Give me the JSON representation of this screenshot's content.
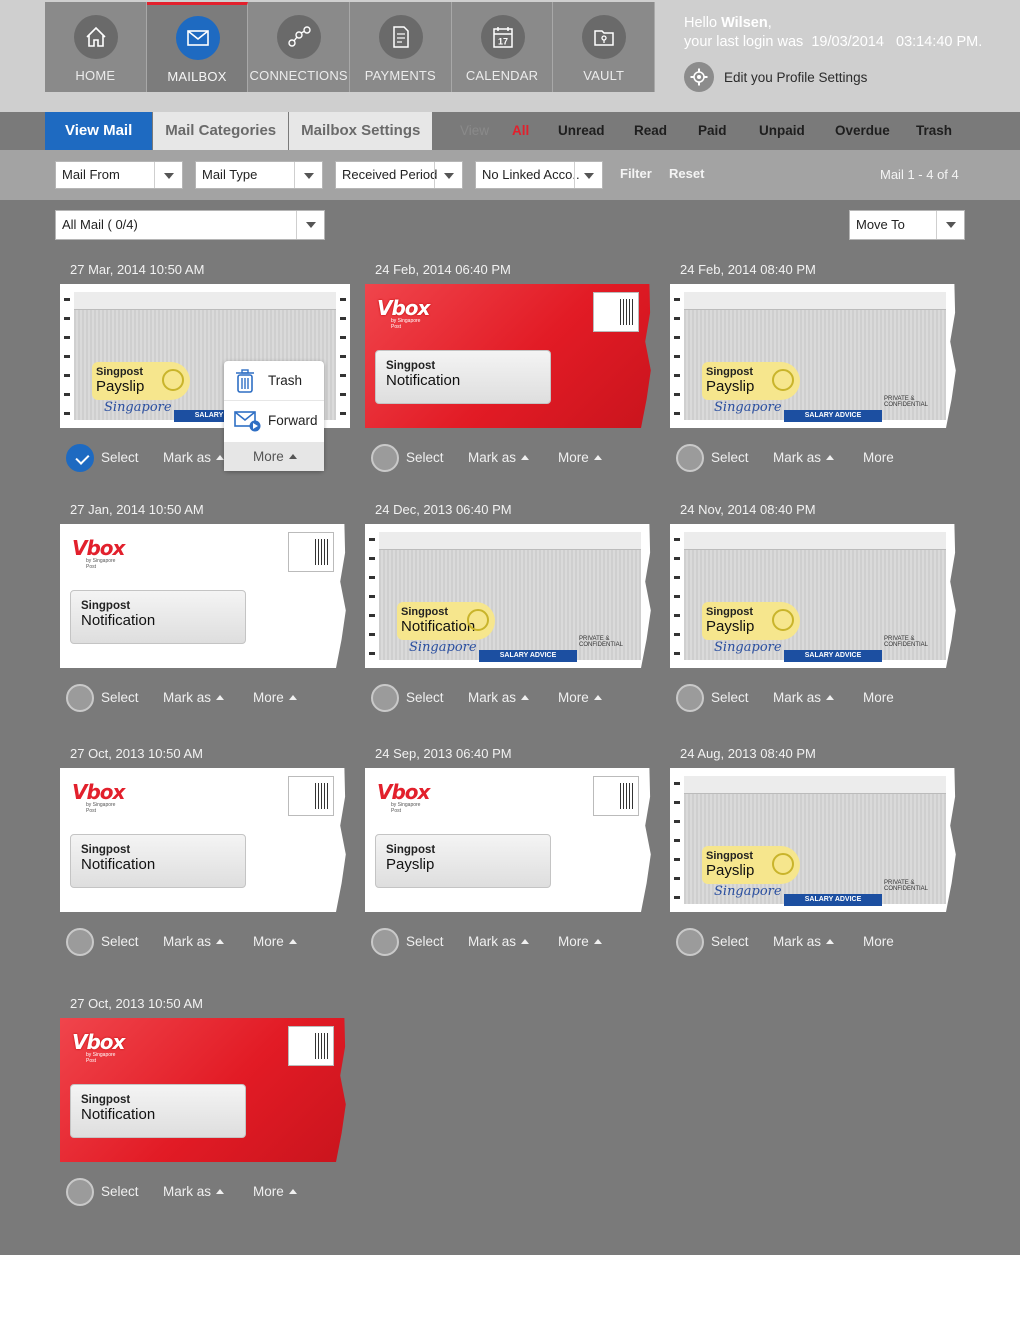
{
  "nav": [
    {
      "label": "HOME",
      "icon": "home-icon"
    },
    {
      "label": "MAILBOX",
      "icon": "mailbox-icon",
      "active": true
    },
    {
      "label": "CONNECTIONS",
      "icon": "connections-icon"
    },
    {
      "label": "PAYMENTS",
      "icon": "payments-icon"
    },
    {
      "label": "CALENDAR",
      "icon": "calendar-icon"
    },
    {
      "label": "VAULT",
      "icon": "vault-icon"
    }
  ],
  "calendar_day": "17",
  "user": {
    "hello": "Hello",
    "name": "Wilsen",
    "comma": ",",
    "last_login_prefix": "your last login was",
    "last_login_date": "19/03/2014",
    "last_login_time": "03:14:40 PM.",
    "profile_link": "Edit you Profile Settings"
  },
  "tabs": [
    "View Mail",
    "Mail Categories",
    "Mailbox Settings"
  ],
  "view": {
    "label": "View",
    "options": [
      "All",
      "Unread",
      "Read",
      "Paid",
      "Unpaid",
      "Overdue",
      "Trash"
    ],
    "active": "All"
  },
  "filters": {
    "mail_from": "Mail From",
    "mail_type": "Mail Type",
    "received_period": "Received Period",
    "linked_account": "No Linked Acco..",
    "filter": "Filter",
    "reset": "Reset",
    "count": "Mail 1 - 4 of 4"
  },
  "all_mail_select": "All Mail ( 0/4)",
  "move_to": "Move To",
  "actions": {
    "select": "Select",
    "mark_as": "Mark as",
    "more": "More"
  },
  "popup": {
    "trash": "Trash",
    "forward": "Forward",
    "more": "More"
  },
  "brand": {
    "vbox": "Vbox",
    "vbox_sub": "by Singapore Post",
    "sg_logo": "Singapore",
    "salary_advice": "SALARY ADVICE",
    "private": "PRIVATE & CONFIDENTIAL"
  },
  "colors": {
    "accent_blue": "#1e6ac1",
    "accent_red": "#e2202c",
    "background": "#7a7a7a"
  },
  "mails": [
    {
      "date": "27 Mar, 2014 10:50 AM",
      "style": "payslip",
      "line1": "Singpost",
      "line2": "Payslip",
      "selected": true,
      "more_arrow": true
    },
    {
      "date": "24 Feb, 2014 06:40 PM",
      "style": "red",
      "line1": "Singpost",
      "line2": "Notification",
      "selected": false,
      "more_arrow": true
    },
    {
      "date": "24 Feb, 2014 08:40 PM",
      "style": "payslip",
      "line1": "Singpost",
      "line2": "Payslip",
      "selected": false,
      "more_arrow": false
    },
    {
      "date": "27 Jan, 2014 10:50 AM",
      "style": "white",
      "line1": "Singpost",
      "line2": "Notification",
      "selected": false,
      "more_arrow": true
    },
    {
      "date": "24 Dec, 2013 06:40 PM",
      "style": "payslip",
      "line1": "Singpost",
      "line2": "Notification",
      "selected": false,
      "more_arrow": true
    },
    {
      "date": "24 Nov, 2014 08:40 PM",
      "style": "payslip",
      "line1": "Singpost",
      "line2": "Payslip",
      "selected": false,
      "more_arrow": false
    },
    {
      "date": "27 Oct, 2013 10:50 AM",
      "style": "white",
      "line1": "Singpost",
      "line2": "Notification",
      "selected": false,
      "more_arrow": true
    },
    {
      "date": "24 Sep, 2013 06:40 PM",
      "style": "white",
      "line1": "Singpost",
      "line2": "Payslip",
      "selected": false,
      "more_arrow": true
    },
    {
      "date": "24 Aug, 2013 08:40 PM",
      "style": "payslip",
      "line1": "Singpost",
      "line2": "Payslip",
      "selected": false,
      "more_arrow": false
    },
    {
      "date": "27 Oct, 2013 10:50 AM",
      "style": "red",
      "line1": "Singpost",
      "line2": "Notification",
      "selected": false,
      "more_arrow": true
    }
  ]
}
